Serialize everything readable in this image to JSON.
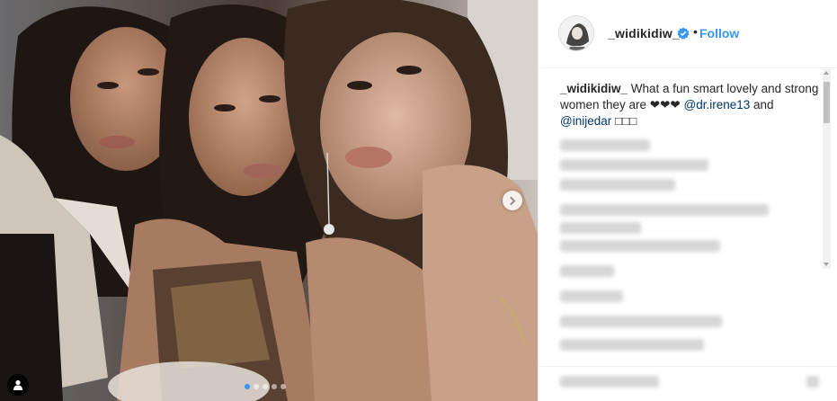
{
  "post": {
    "username": "_widikidiw_",
    "separator": "•",
    "follow_label": "Follow",
    "caption": {
      "username": "_widikidiw_",
      "text": " What a fun smart lovely and strong women they are ❤❤❤ ",
      "mention1": "@dr.irene13",
      "connector": " and ",
      "mention2": "@inijedar",
      "suffix": " □□□"
    }
  },
  "carousel": {
    "slide_count": 5,
    "active_index": 0
  },
  "colors": {
    "accent": "#3897f0",
    "mention": "#003569",
    "text": "#262626"
  },
  "icons": {
    "verified": "verified-badge-icon",
    "next": "chevron-right-icon",
    "tag": "user-tag-icon"
  }
}
